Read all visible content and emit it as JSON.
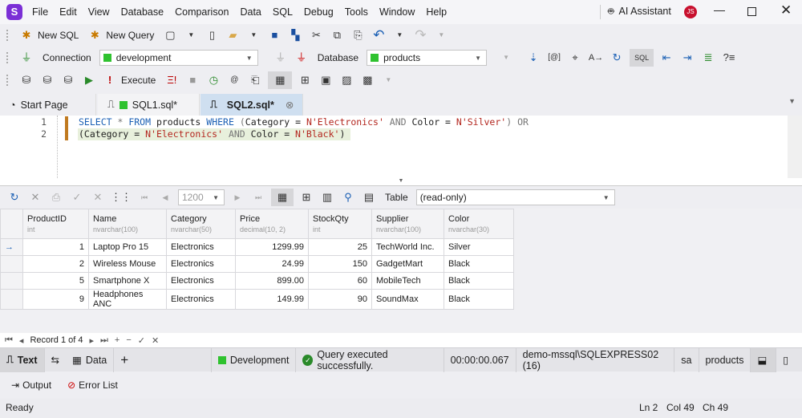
{
  "app": {
    "logo": "S"
  },
  "menu": [
    "File",
    "Edit",
    "View",
    "Database",
    "Comparison",
    "Data",
    "SQL",
    "Debug",
    "Tools",
    "Window",
    "Help"
  ],
  "title_bar": {
    "ai_assistant": "AI Assistant",
    "user_initials": "JS"
  },
  "toolbar1": {
    "new_sql": "New SQL",
    "new_query": "New Query"
  },
  "toolbar2": {
    "connection_label": "Connection",
    "connection_value": "development",
    "database_label": "Database",
    "database_value": "products"
  },
  "toolbar3": {
    "execute": "Execute"
  },
  "tabs": [
    {
      "label": "Start Page"
    },
    {
      "label": "SQL1.sql*"
    },
    {
      "label": "SQL2.sql*",
      "active": true
    }
  ],
  "editor": {
    "line_numbers": [
      "1",
      "2"
    ],
    "line1": [
      {
        "t": "SELECT",
        "c": "kw"
      },
      {
        "t": " * ",
        "c": "op"
      },
      {
        "t": "FROM",
        "c": "kw"
      },
      {
        "t": " products ",
        "c": ""
      },
      {
        "t": "WHERE",
        "c": "kw"
      },
      {
        "t": " (",
        "c": "op"
      },
      {
        "t": "Category = ",
        "c": ""
      },
      {
        "t": "N'Electronics'",
        "c": "str"
      },
      {
        "t": " AND ",
        "c": "op"
      },
      {
        "t": "Color = ",
        "c": ""
      },
      {
        "t": "N'Silver'",
        "c": "str"
      },
      {
        "t": ") ",
        "c": "op"
      },
      {
        "t": "OR",
        "c": "op"
      }
    ],
    "line2": [
      {
        "t": "(Category = ",
        "c": ""
      },
      {
        "t": "N'Electronics'",
        "c": "str"
      },
      {
        "t": " AND ",
        "c": "op"
      },
      {
        "t": "Color = ",
        "c": ""
      },
      {
        "t": "N'Black'",
        "c": "str"
      },
      {
        "t": ")",
        "c": ""
      }
    ]
  },
  "grid_toolbar": {
    "page_size": "1200",
    "view_label": "Table",
    "view_value": "(read-only)"
  },
  "grid": {
    "columns": [
      {
        "name": "ProductID",
        "type": "int"
      },
      {
        "name": "Name",
        "type": "nvarchar(100)"
      },
      {
        "name": "Category",
        "type": "nvarchar(50)"
      },
      {
        "name": "Price",
        "type": "decimal(10, 2)"
      },
      {
        "name": "StockQty",
        "type": "int"
      },
      {
        "name": "Supplier",
        "type": "nvarchar(100)"
      },
      {
        "name": "Color",
        "type": "nvarchar(30)"
      }
    ],
    "rows": [
      [
        "1",
        "Laptop Pro 15",
        "Electronics",
        "1299.99",
        "25",
        "TechWorld Inc.",
        "Silver"
      ],
      [
        "2",
        "Wireless Mouse",
        "Electronics",
        "24.99",
        "150",
        "GadgetMart",
        "Black"
      ],
      [
        "5",
        "Smartphone X",
        "Electronics",
        "899.00",
        "60",
        "MobileTech",
        "Black"
      ],
      [
        "9",
        "Headphones ANC",
        "Electronics",
        "149.99",
        "90",
        "SoundMax",
        "Black"
      ]
    ]
  },
  "nav": {
    "record": "Record 1 of 4"
  },
  "bottom_tabs": {
    "text": "Text",
    "data": "Data",
    "plus": "+",
    "env": "Development",
    "message": "Query executed successfully.",
    "time": "00:00:00.067",
    "server": "demo-mssql\\SQLEXPRESS02 (16)",
    "user": "sa",
    "database": "products"
  },
  "output_tabs": {
    "output": "Output",
    "error_list": "Error List"
  },
  "status": {
    "ready": "Ready",
    "ln": "Ln 2",
    "col": "Col 49",
    "ch": "Ch 49"
  }
}
